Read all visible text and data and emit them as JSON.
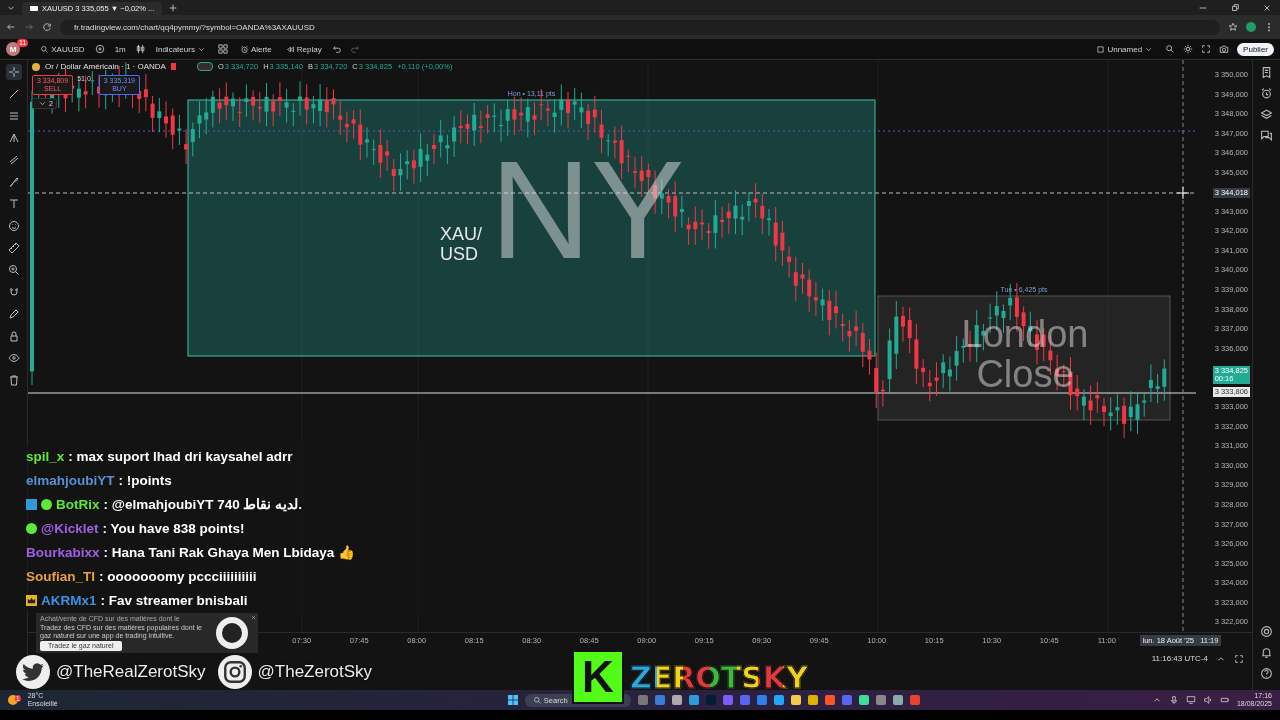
{
  "browser": {
    "tab_title": "XAUUSD 3 335,055 ▼ −0,02% ...",
    "url": "fr.tradingview.com/chart/qq4pymmy/?symbol=OANDA%3AXAUUSD"
  },
  "toolbar": {
    "avatar": "M",
    "avatar_badge": "11",
    "symbol": "XAUUSD",
    "interval": "1m",
    "indicators": "Indicateurs",
    "alert": "Alerte",
    "replay": "Replay",
    "layout_name": "Unnamed",
    "publish": "Publier"
  },
  "legend": {
    "title": "Or / Dollar Américain · 1 · OANDA",
    "ohlc": [
      {
        "key": "O",
        "value": "3 334,720"
      },
      {
        "key": "H",
        "value": "3 335,140"
      },
      {
        "key": "B",
        "value": "3 334,720"
      },
      {
        "key": "C",
        "value": "3 334,825"
      }
    ],
    "change": "+0,110 (+0,00%)",
    "sell_price": "3 334,809",
    "sell_label": "SELL",
    "spread": "51,0",
    "buy_price": "3 335,319",
    "buy_label": "BUY",
    "collapse_count": "2"
  },
  "sessions": [
    {
      "kind": "ny",
      "label": "Hon • 13,11 pts",
      "watermark": "NY",
      "symbol_text": "XAU/ USD"
    },
    {
      "kind": "london",
      "label": "Tue • 6,425 pts",
      "watermark": "London Close"
    }
  ],
  "price_axis": {
    "labels_upper": [
      "3 350,000",
      "3 349,000",
      "3 348,000",
      "3 347,000",
      "3 346,000",
      "3 345,000"
    ],
    "labels_middle": [
      "3 343,000",
      "3 342,000",
      "3 341,000",
      "3 340,000",
      "3 339,000",
      "3 338,000",
      "3 337,000",
      "3 336,000"
    ],
    "labels_lower": [
      "3 333,000",
      "3 332,000",
      "3 331,000",
      "3 330,000",
      "3 329,000",
      "3 328,000",
      "3 327,000",
      "3 326,000",
      "3 325,000",
      "3 324,000",
      "3 323,000",
      "3 322,000"
    ],
    "crosshair_price": "3 344,018",
    "last_price": "3 334,825",
    "countdown": "00:16",
    "line_price": "3 333,806"
  },
  "time_axis": {
    "labels": [
      "07:30",
      "07:45",
      "08:00",
      "08:15",
      "08:30",
      "08:45",
      "09:00",
      "09:15",
      "09:30",
      "09:45",
      "10:00",
      "10:15",
      "10:30",
      "10:45",
      "11:00"
    ],
    "crosshair_time": "lun. 18 Août '25   11:19",
    "clock": "11:16:43 UTC-4"
  },
  "chat": [
    {
      "user": "spil_x",
      "color": "#5de83a",
      "bot": false,
      "verified": false,
      "crown": false,
      "message": ": max suport lhad dri kaysahel adrr"
    },
    {
      "user": "elmahjoubiYT",
      "color": "#5b8fd6",
      "bot": false,
      "verified": false,
      "crown": false,
      "message": ": !points"
    },
    {
      "user": "BotRix",
      "color": "#5de83a",
      "bot": true,
      "verified": true,
      "crown": false,
      "message": ": @elmahjoubiYT 740 لديه نقاط."
    },
    {
      "user": "@Kicklet",
      "color": "#a25ee6",
      "bot": false,
      "verified": true,
      "crown": false,
      "message": ": You have 838 points!"
    },
    {
      "user": "Bourkabixx",
      "color": "#a25ee6",
      "bot": false,
      "verified": false,
      "crown": false,
      "message": ": Hana Tani Rak Ghaya Men Lbidaya 👍"
    },
    {
      "user": "Soufian_TI",
      "color": "#e6a23c",
      "bot": false,
      "verified": false,
      "crown": false,
      "message": ": ooooooomy pccciiiiiiiiii"
    },
    {
      "user": "AKRMx1",
      "color": "#3d8fe0",
      "bot": false,
      "verified": false,
      "crown": true,
      "message": ": Fav streamer bnisbali"
    }
  ],
  "ad": {
    "headline": "Achat/vente de CFD sur des matières dont le",
    "body": "Tradez des CFD sur des matières populaires dont le gaz naturel sur une app de trading intuitive.",
    "button": "Tradez le gaz naturel"
  },
  "socials": [
    {
      "kind": "twitter",
      "handle": "@TheRealZerotSky"
    },
    {
      "kind": "instagram",
      "handle": "@TheZerotSky"
    }
  ],
  "logo": {
    "letter": "K",
    "name": "ZEROTSKY"
  },
  "taskbar": {
    "temperature": "28°C",
    "weather": "Ensoleillé",
    "weather_badge": "1",
    "search": "Search",
    "time": "17:16",
    "date": "18/08/2025"
  }
}
